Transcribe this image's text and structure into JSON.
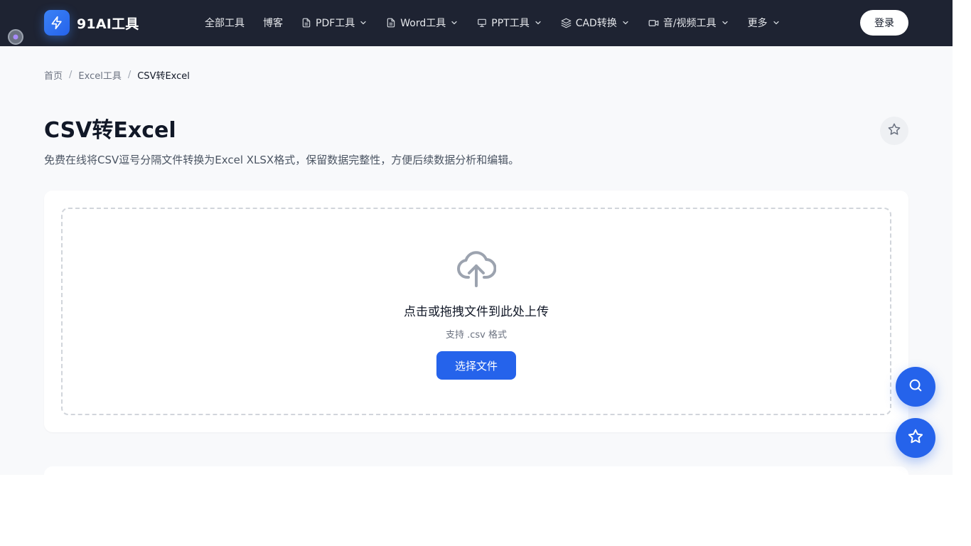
{
  "header": {
    "logo_text": "91AI工具",
    "nav": [
      {
        "label": "全部工具"
      },
      {
        "label": "博客"
      },
      {
        "label": "PDF工具"
      },
      {
        "label": "Word工具"
      },
      {
        "label": "PPT工具"
      },
      {
        "label": "CAD转换"
      },
      {
        "label": "音/视频工具"
      },
      {
        "label": "更多"
      }
    ],
    "login_label": "登录"
  },
  "breadcrumb": [
    {
      "label": "首页"
    },
    {
      "label": "Excel工具"
    },
    {
      "label": "CSV转Excel"
    }
  ],
  "breadcrumb_sep": "/",
  "page": {
    "title": "CSV转Excel",
    "description": "免费在线将CSV逗号分隔文件转换为Excel XLSX格式，保留数据完整性，方便后续数据分析和编辑。"
  },
  "upload": {
    "main_text": "点击或拖拽文件到此处上传",
    "sub_text": "支持 .csv 格式",
    "button_label": "选择文件"
  },
  "icons": {
    "logo": "lightning-icon",
    "pdf": "document-icon",
    "word": "document-icon",
    "ppt": "presentation-icon",
    "cad": "layers-icon",
    "video": "video-camera-icon",
    "favorite": "star-icon",
    "upload": "cloud-upload-icon",
    "search": "search-icon"
  },
  "colors": {
    "header_bg": "#1e2332",
    "accent": "#2563eb",
    "page_bg": "#f8f9fb"
  }
}
